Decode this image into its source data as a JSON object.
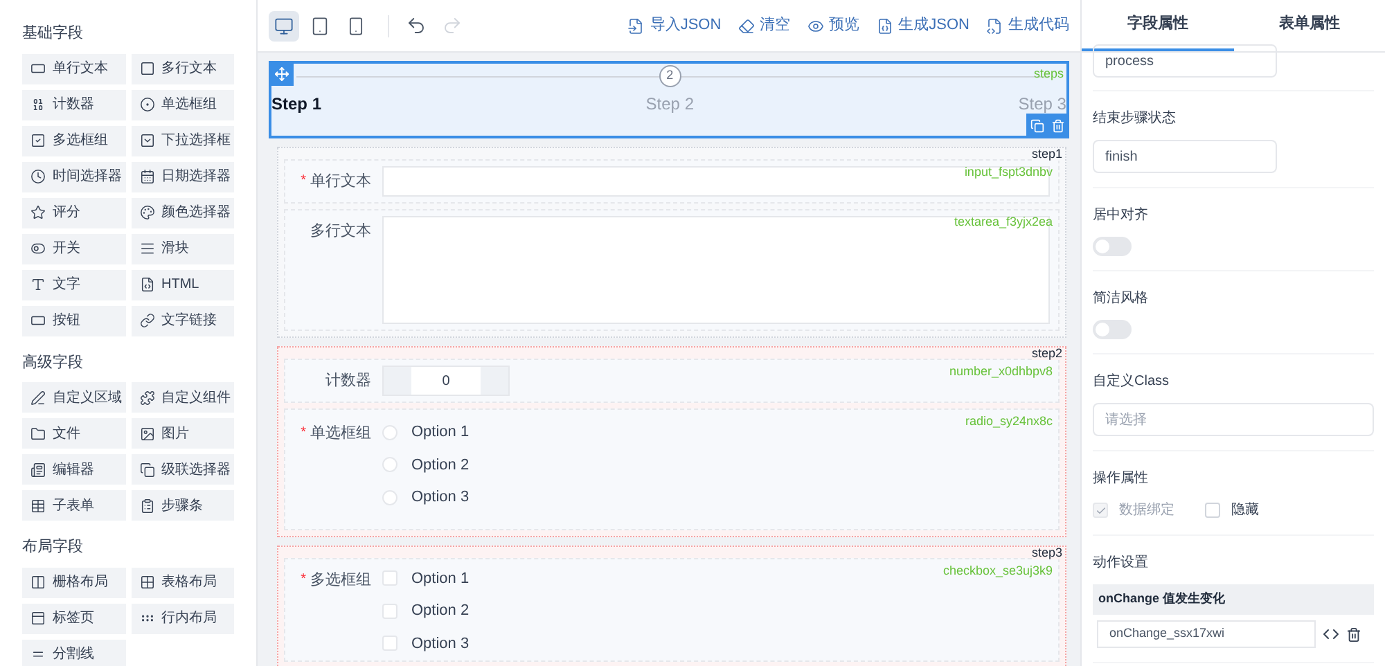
{
  "palette": [
    {
      "title": "基础字段",
      "items": [
        "单行文本",
        "多行文本",
        "计数器",
        "单选框组",
        "多选框组",
        "下拉选择框",
        "时间选择器",
        "日期选择器",
        "评分",
        "颜色选择器",
        "开关",
        "滑块",
        "文字",
        "HTML",
        "按钮",
        "文字链接"
      ]
    },
    {
      "title": "高级字段",
      "items": [
        "自定义区域",
        "自定义组件",
        "文件",
        "图片",
        "编辑器",
        "级联选择器",
        "子表单",
        "步骤条"
      ]
    },
    {
      "title": "布局字段",
      "items": [
        "栅格布局",
        "表格布局",
        "标签页",
        "行内布局",
        "分割线"
      ]
    }
  ],
  "toolbar": {
    "devices": [
      {
        "selected": true
      },
      {
        "selected": false
      },
      {
        "selected": false
      }
    ],
    "history": [
      {
        "disabled": false
      },
      {
        "disabled": true
      }
    ],
    "actions": [
      "导入JSON",
      "清空",
      "预览",
      "生成JSON",
      "生成代码"
    ]
  },
  "steps_widget": {
    "selected": true,
    "tag": "steps",
    "steps": [
      {
        "title": "Step 1",
        "active": true
      },
      {
        "title": "Step 2",
        "number": "2",
        "active": false
      },
      {
        "title": "Step 3",
        "active": false
      }
    ]
  },
  "groups": [
    {
      "tag": "step1",
      "highlighted": false,
      "fields": [
        {
          "kind": "input",
          "label": "单行文本",
          "required_mark": "*",
          "tag": "input_fspt3dnbv"
        },
        {
          "kind": "textarea",
          "label": "多行文本",
          "tag": "textarea_f3yjx2ea"
        }
      ]
    },
    {
      "tag": "step2",
      "highlighted": true,
      "fields": [
        {
          "kind": "number",
          "label": "计数器",
          "value": "0",
          "tag": "number_x0dhbpv8"
        },
        {
          "kind": "radio",
          "label": "单选框组",
          "required_mark": "*",
          "tag": "radio_sy24nx8c",
          "options": [
            {
              "label": "Option 1",
              "selected": false
            },
            {
              "label": "Option 2",
              "selected": false
            },
            {
              "label": "Option 3",
              "selected": false
            }
          ]
        }
      ]
    },
    {
      "tag": "step3",
      "highlighted": true,
      "fields": [
        {
          "kind": "checkbox",
          "label": "多选框组",
          "required_mark": "*",
          "tag": "checkbox_se3uj3k9",
          "options": [
            {
              "label": "Option 1",
              "checked": false
            },
            {
              "label": "Option 2",
              "checked": false
            },
            {
              "label": "Option 3",
              "checked": false
            }
          ]
        }
      ]
    }
  ],
  "panel": {
    "tabs": [
      {
        "label": "字段属性",
        "selected": true
      },
      {
        "label": "表单属性",
        "selected": false
      }
    ],
    "props": [
      {
        "kind": "input",
        "value": "process"
      },
      {
        "kind": "input",
        "label": "结束步骤状态",
        "value": "finish"
      },
      {
        "kind": "switch",
        "label": "居中对齐",
        "on": false
      },
      {
        "kind": "switch",
        "label": "简洁风格",
        "on": false
      },
      {
        "kind": "select",
        "label": "自定义Class",
        "placeholder": "请选择"
      },
      {
        "kind": "checks",
        "label": "操作属性",
        "options": [
          {
            "label": "数据绑定",
            "checked": true,
            "disabled": true
          },
          {
            "label": "隐藏",
            "checked": false,
            "disabled": false
          }
        ]
      },
      {
        "kind": "actions",
        "label": "动作设置",
        "header": "onChange 值发生变化",
        "value": "onChange_ssx17xwi"
      }
    ]
  }
}
